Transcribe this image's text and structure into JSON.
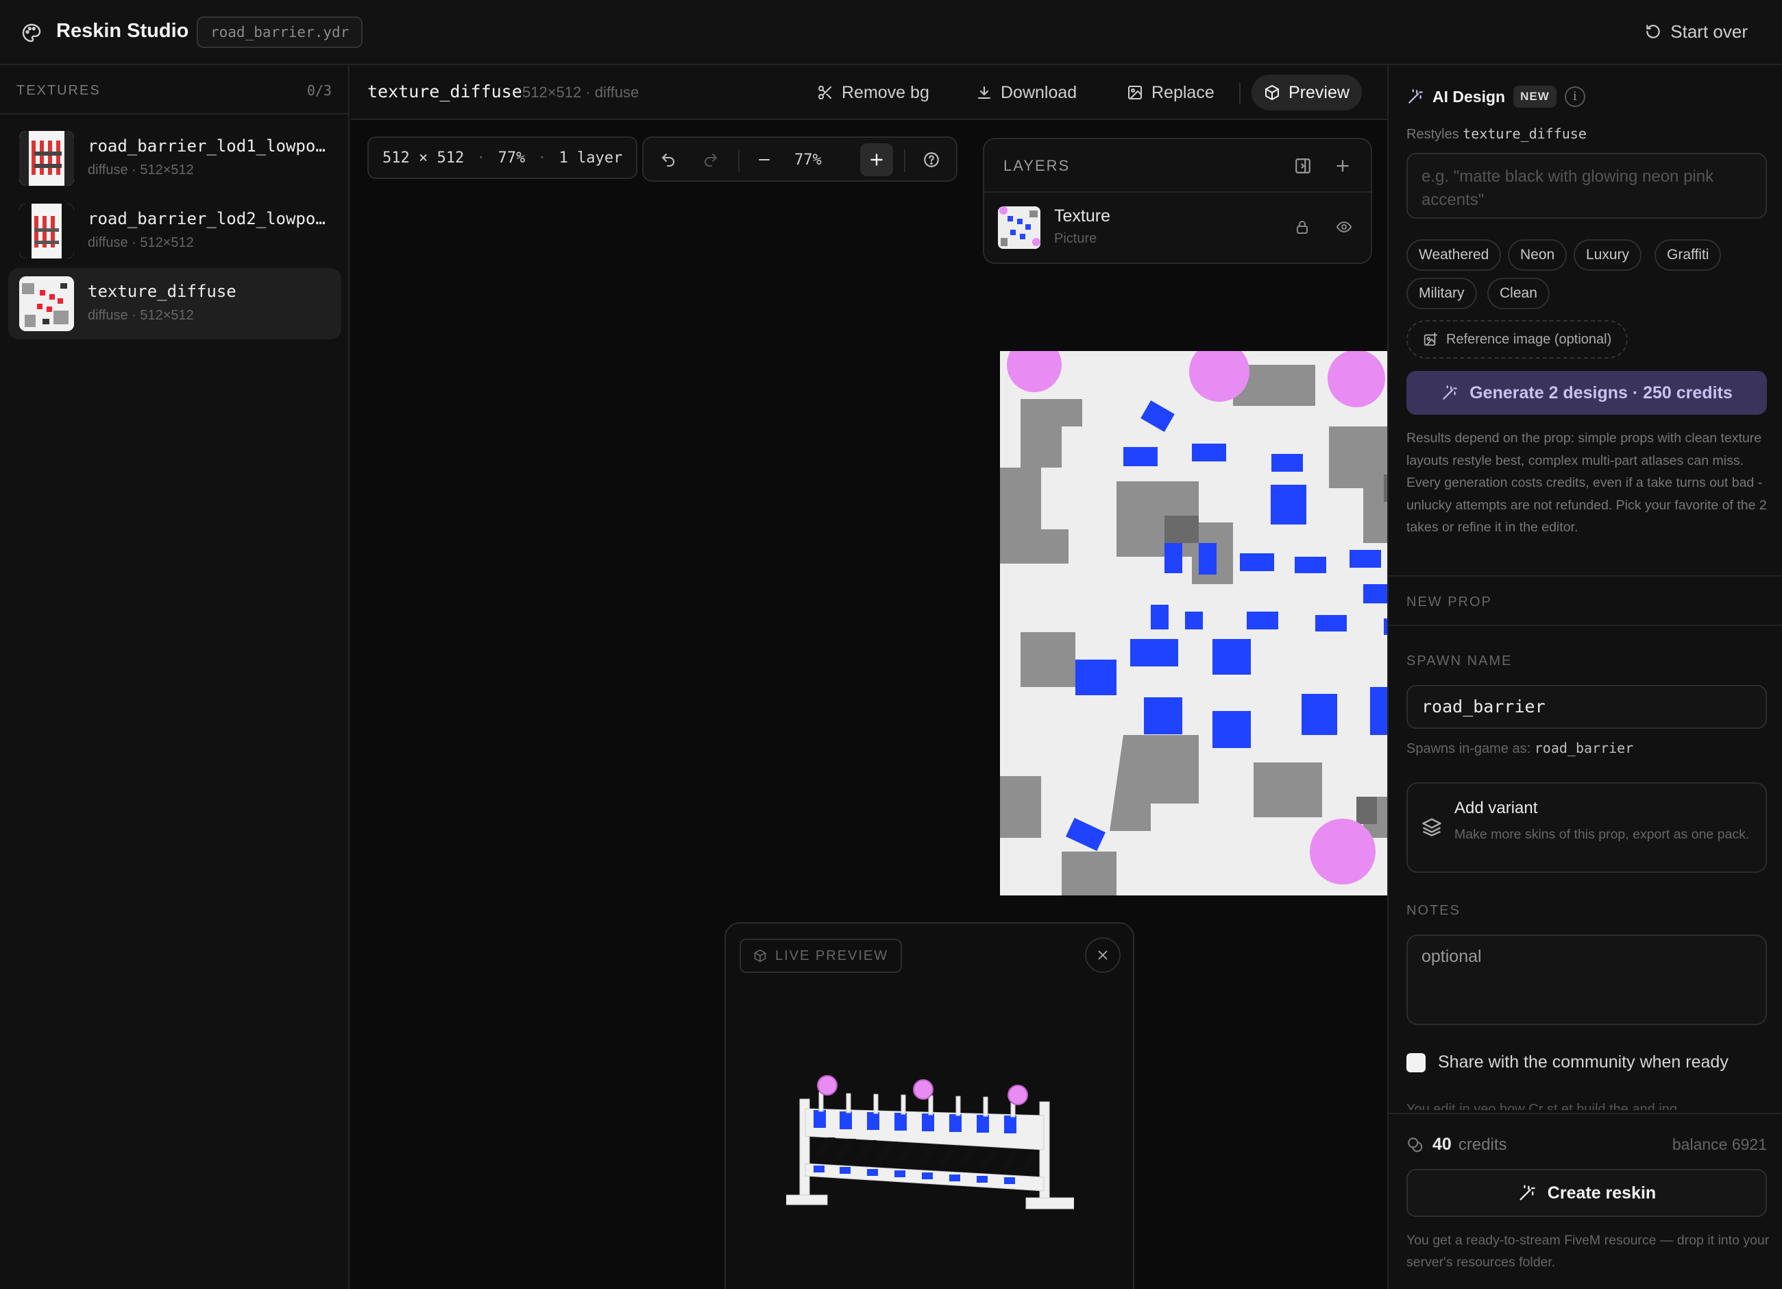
{
  "app": {
    "title": "Reskin Studio",
    "file_name": "road_barrier.ydr",
    "start_over_label": "Start over"
  },
  "textures_panel": {
    "label": "TEXTURES",
    "count": "0/3",
    "items": [
      {
        "name": "road_barrier_lod1_lowpol…",
        "meta": "diffuse · 512×512"
      },
      {
        "name": "road_barrier_lod2_lowpol…",
        "meta": "diffuse · 512×512"
      },
      {
        "name": "texture_diffuse",
        "meta": "diffuse · 512×512"
      }
    ]
  },
  "editor": {
    "texture_name": "texture_diffuse",
    "texture_meta": "512×512 · diffuse",
    "toolbar": {
      "remove_bg": "Remove bg",
      "download": "Download",
      "replace": "Replace",
      "preview": "Preview"
    },
    "info": {
      "size": "512 × 512",
      "zoom": "77%",
      "layers": "1 layer"
    },
    "zoom_value": "77%",
    "layers_panel": {
      "title": "LAYERS",
      "layer_name": "Texture",
      "layer_type": "Picture"
    },
    "live_preview_label": "LIVE PREVIEW"
  },
  "ai_design": {
    "title": "AI Design",
    "badge": "NEW",
    "info": "i",
    "restyles_prefix": "Restyles",
    "restyles_target": "texture_diffuse",
    "prompt_placeholder": "e.g. \"matte black with glowing neon pink accents\"",
    "chips": [
      "Weathered",
      "Neon",
      "Luxury",
      "Graffiti",
      "Military",
      "Clean"
    ],
    "reference_label": "Reference image (optional)",
    "generate_label": "Generate 2 designs · 250 credits",
    "disclaimer": "Results depend on the prop: simple props with clean texture layouts restyle best, complex multi-part atlases can miss. Every generation costs credits, even if a take turns out bad - unlucky attempts are not refunded. Pick your favorite of the 2 takes or refine it in the editor."
  },
  "new_prop": {
    "section_label": "NEW PROP",
    "spawn_label": "SPAWN NAME",
    "spawn_value": "road_barrier",
    "spawns_as_prefix": "Spawns in-game as:",
    "spawns_as_value": "road_barrier",
    "variant_title": "Add variant",
    "variant_sub": "Make more skins of this prop, export as one pack.",
    "notes_label": "NOTES",
    "notes_placeholder": "optional",
    "share_label": "Share with the community when ready",
    "cut_text": "You edit in yeo how Cr st et build the and ing"
  },
  "footer": {
    "credits_value": "40",
    "credits_label": "credits",
    "balance": "balance 6921",
    "create_label": "Create reskin",
    "footnote": "You get a ready-to-stream FiveM resource — drop it into your server's resources folder."
  },
  "colors": {
    "accent_purple": "#3a335c",
    "accent_text": "#c9c2ef",
    "texture_blue": "#1f44ff",
    "texture_pink": "#e88cf3"
  }
}
